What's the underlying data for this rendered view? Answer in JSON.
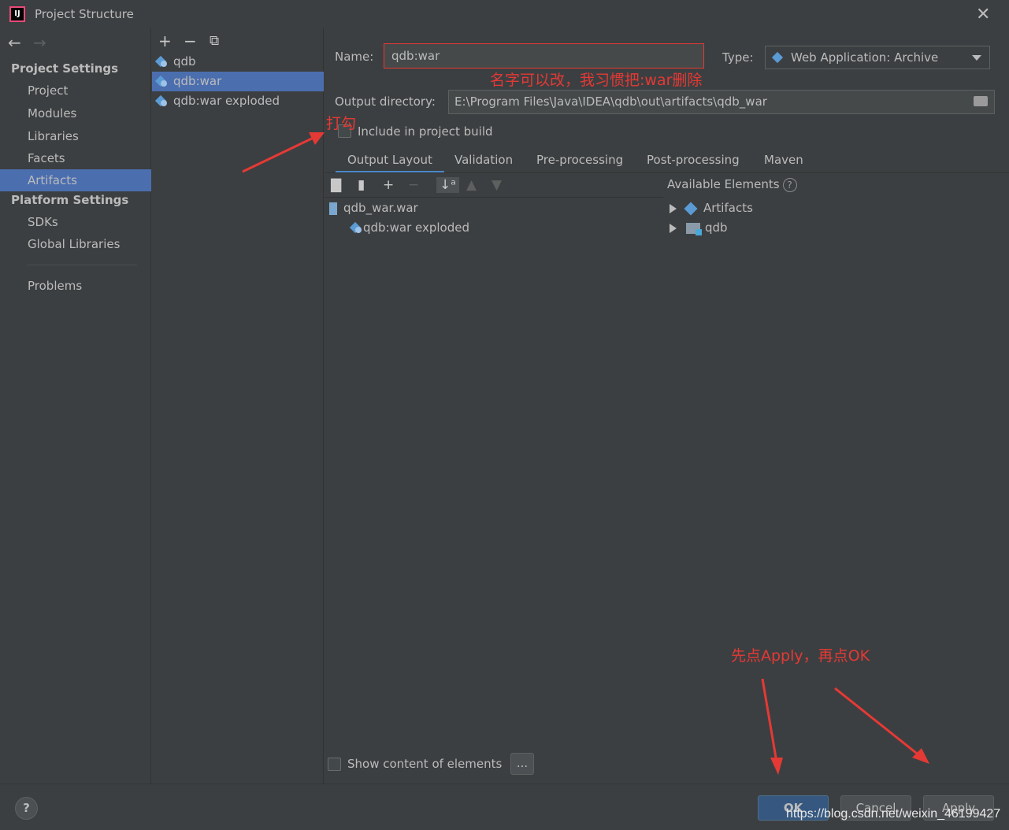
{
  "window": {
    "title": "Project Structure",
    "logo": "IJ"
  },
  "left_nav": {
    "project_settings_header": "Project Settings",
    "project_items": [
      "Project",
      "Modules",
      "Libraries",
      "Facets",
      "Artifacts"
    ],
    "platform_settings_header": "Platform Settings",
    "platform_items": [
      "SDKs",
      "Global Libraries"
    ],
    "problems": "Problems",
    "selected": "Artifacts"
  },
  "artifact_list": {
    "items": [
      "qdb",
      "qdb:war",
      "qdb:war exploded"
    ],
    "selected": "qdb:war"
  },
  "form": {
    "name_label": "Name:",
    "name_value": "qdb:war",
    "type_label": "Type:",
    "type_value": "Web Application: Archive",
    "output_label": "Output directory:",
    "output_value": "E:\\Program Files\\Java\\IDEA\\qdb\\out\\artifacts\\qdb_war",
    "include_label": "Include in project build",
    "include_checked": false
  },
  "tabs": [
    "Output Layout",
    "Validation",
    "Pre-processing",
    "Post-processing",
    "Maven"
  ],
  "selected_tab": "Output Layout",
  "layout_tree": {
    "root": "qdb_war.war",
    "child": "qdb:war exploded"
  },
  "available": {
    "header": "Available Elements",
    "items": [
      "Artifacts",
      "qdb"
    ]
  },
  "show_content_label": "Show content of elements",
  "ellipsis": "...",
  "buttons": {
    "help": "?",
    "ok": "OK",
    "cancel": "Cancel",
    "apply": "Apply"
  },
  "annotations": {
    "name_note": "名字可以改，我习惯把:war删除",
    "check_note": "打勾",
    "apply_note": "先点Apply，再点OK"
  },
  "watermark": "https://blog.csdn.net/weixin_46199427",
  "colors": {
    "accent": "#4b6eaf",
    "annotation": "#e53935",
    "background": "#3c3f41"
  }
}
